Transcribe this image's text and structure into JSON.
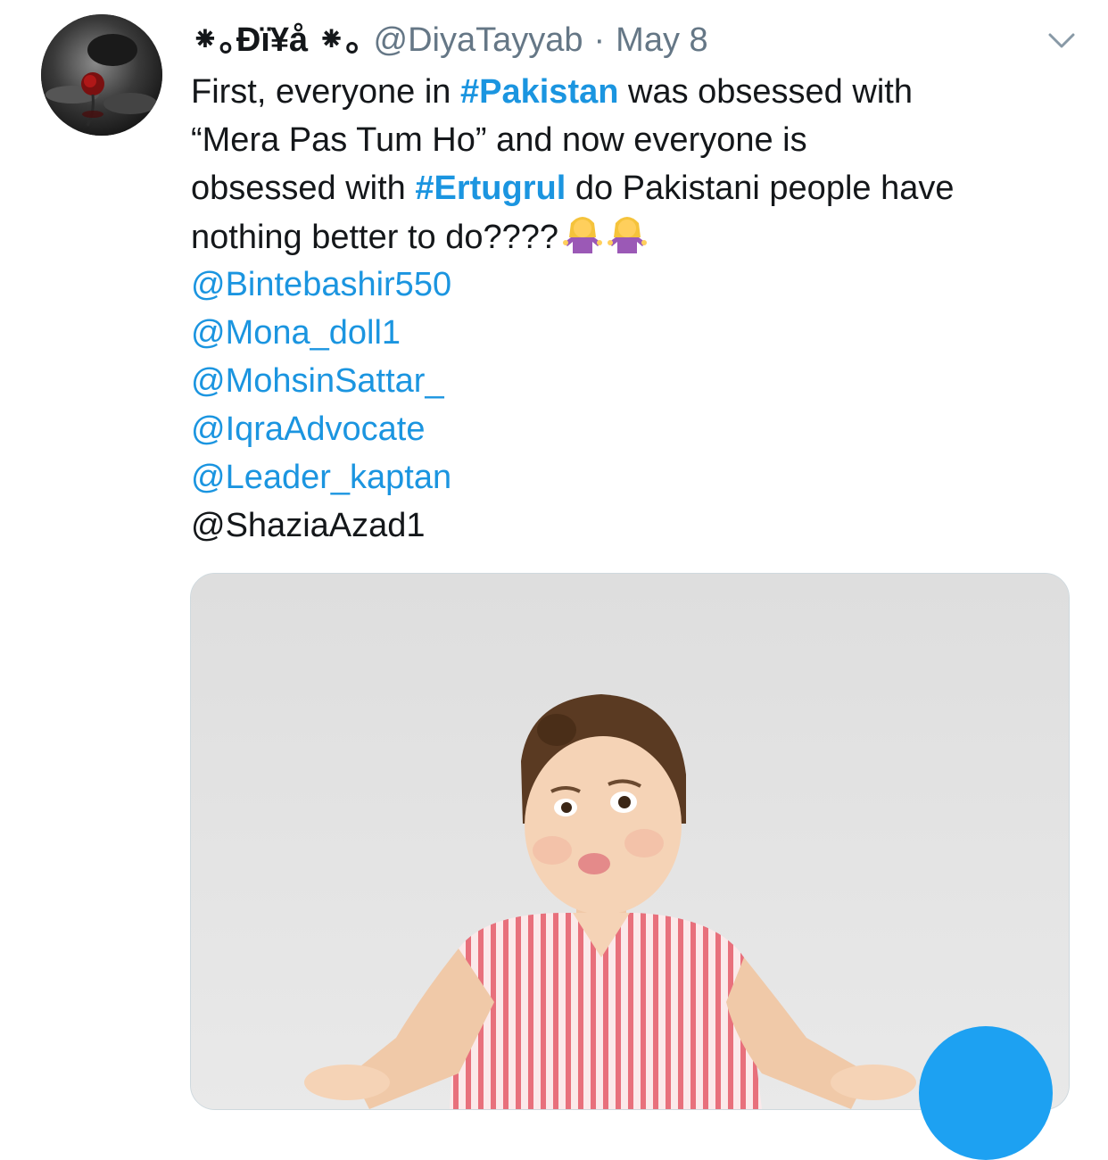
{
  "tweet": {
    "display_name": "⁕｡Đï¥å ⁕｡",
    "handle": "@DiyaTayyab",
    "separator": "·",
    "date": "May 8",
    "text": {
      "l1_a": "First, everyone in ",
      "l1_hashtag": "#Pakistan",
      "l1_b": " was obsessed with",
      "l2": "“Mera Pas Tum Ho” and now everyone is",
      "l3_a": "obsessed with ",
      "l3_hashtag": "#Ertugrul",
      "l3_b": " do Pakistani people have",
      "l4": "nothing better to do????"
    },
    "mentions": [
      "@Bintebashir550",
      "@Mona_doll1",
      "@MohsinSattar_",
      "@IqraAdvocate",
      "@Leader_kaptan"
    ],
    "last_mention": "@ShaziaAzad1"
  },
  "icons": {
    "caret": "chevron-down-icon",
    "emoji": "woman-shrugging-emoji",
    "compose": "compose-fab"
  },
  "colors": {
    "link": "#1b95e0",
    "text": "#14171a",
    "muted": "#657786",
    "fab": "#1da1f2"
  }
}
